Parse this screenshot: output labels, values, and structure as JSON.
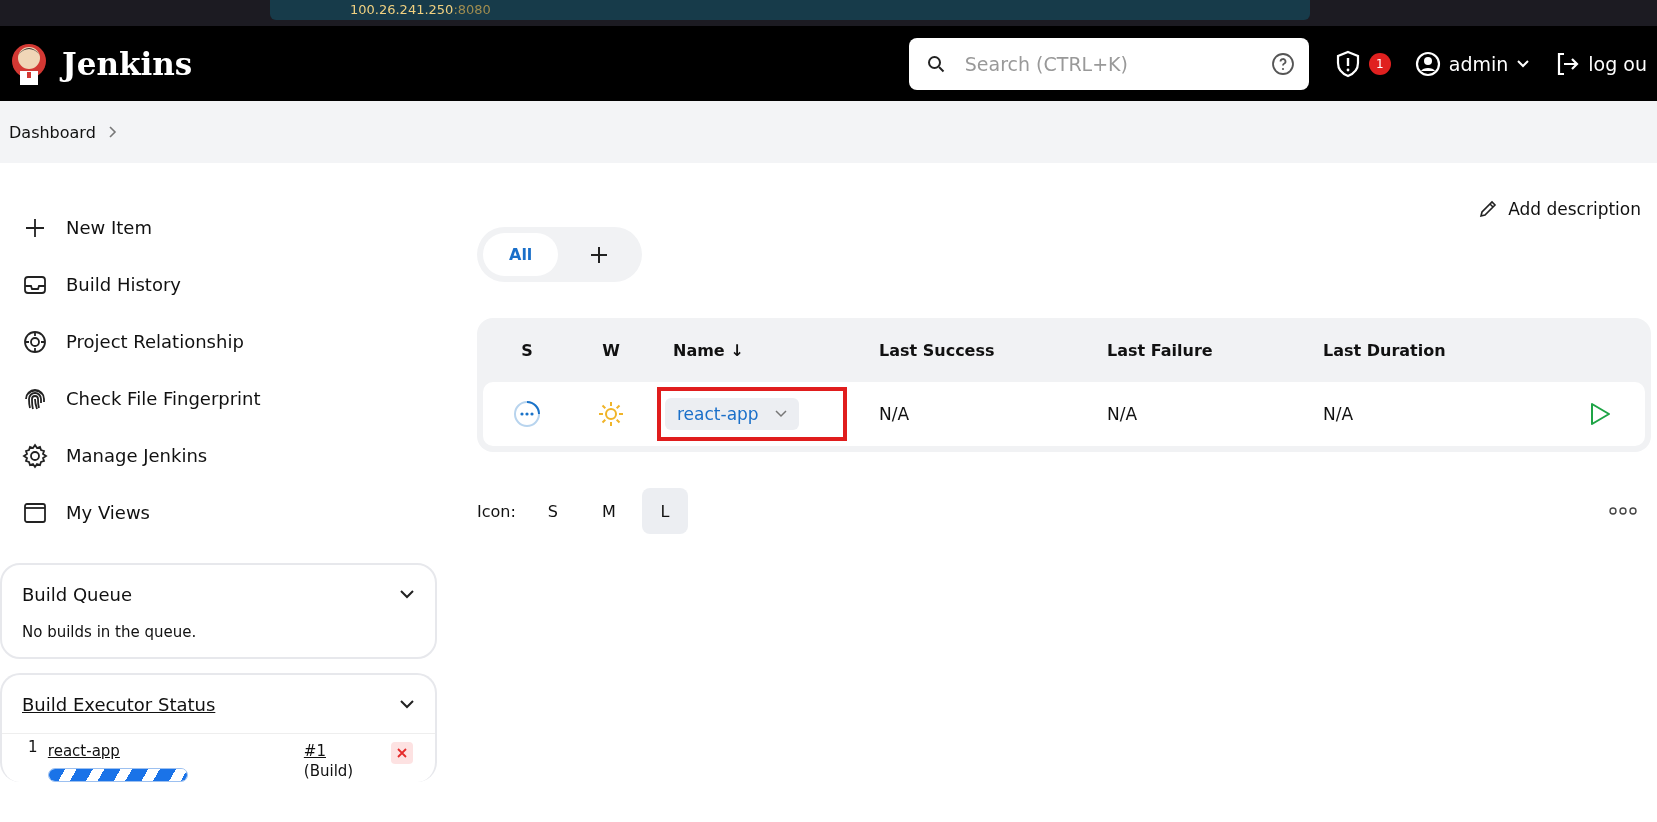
{
  "browser": {
    "url_host": "100.26.241.250",
    "url_port": ":8080"
  },
  "header": {
    "title": "Jenkins",
    "search": {
      "placeholder": "Search (CTRL+K)"
    },
    "alerts": "1",
    "user": "admin",
    "logout": "log ou"
  },
  "breadcrumb": [
    "Dashboard"
  ],
  "sidebar": {
    "items": [
      {
        "kind": "plus",
        "label": "New Item"
      },
      {
        "kind": "history",
        "label": "Build History"
      },
      {
        "kind": "relation",
        "label": "Project Relationship"
      },
      {
        "kind": "fingerprint",
        "label": "Check File Fingerprint"
      },
      {
        "kind": "gear",
        "label": "Manage Jenkins"
      },
      {
        "kind": "window",
        "label": "My Views"
      }
    ],
    "build_queue": {
      "title": "Build Queue",
      "message": "No builds in the queue."
    },
    "executors": {
      "title": "Build Executor Status",
      "rows": [
        {
          "number": "1",
          "job": "react-app",
          "build": "#1",
          "note": "(Build)",
          "level": 1
        }
      ]
    }
  },
  "add_description": "Add description",
  "views": [
    {
      "label": "All",
      "selected": true
    }
  ],
  "table": {
    "columns": [
      "S",
      "W",
      "Name ↓",
      "Last Success",
      "Last Failure",
      "Last Duration"
    ],
    "rows": [
      {
        "name": "react-app",
        "highlighted": true,
        "last_success": "N/A",
        "last_failure": "N/A",
        "last_duration": "N/A"
      }
    ]
  },
  "icon_sizes": {
    "label": "Icon:",
    "options": [
      {
        "label": "S",
        "selected": false
      },
      {
        "label": "M",
        "selected": false
      },
      {
        "label": "L",
        "selected": true
      }
    ]
  }
}
